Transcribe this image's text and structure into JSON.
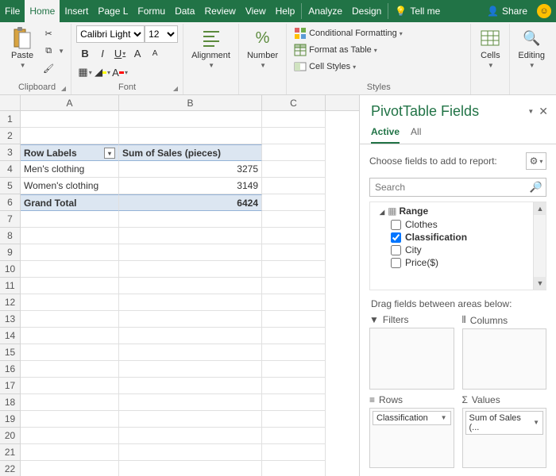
{
  "menubar": {
    "tabs": [
      "File",
      "Home",
      "Insert",
      "Page L",
      "Formu",
      "Data",
      "Review",
      "View",
      "Help",
      "Analyze",
      "Design"
    ],
    "active": "Home",
    "tellme": "Tell me",
    "share": "Share"
  },
  "ribbon": {
    "clipboard": {
      "label": "Clipboard",
      "paste": "Paste"
    },
    "font": {
      "label": "Font",
      "name": "Calibri Light",
      "size": "12",
      "bold": "B",
      "italic": "I",
      "underline": "U"
    },
    "alignment": {
      "label": "Alignment"
    },
    "number": {
      "label": "Number"
    },
    "styles": {
      "label": "Styles",
      "cond": "Conditional Formatting",
      "table": "Format as Table",
      "cell": "Cell Styles"
    },
    "cells": {
      "label": "Cells"
    },
    "editing": {
      "label": "Editing"
    }
  },
  "sheet": {
    "cols": [
      "A",
      "B",
      "C"
    ],
    "pivot": {
      "row_header": "Row Labels",
      "val_header": "Sum of Sales (pieces)",
      "rows": [
        {
          "label": "Men's clothing",
          "value": "3275"
        },
        {
          "label": "Women's clothing",
          "value": "3149"
        }
      ],
      "total_label": "Grand Total",
      "total_value": "6424"
    }
  },
  "pane": {
    "title": "PivotTable Fields",
    "tabs": {
      "active": "Active",
      "all": "All"
    },
    "hint": "Choose fields to add to report:",
    "search_placeholder": "Search",
    "group": "Range",
    "fields": [
      {
        "name": "Clothes",
        "checked": false,
        "bold": false
      },
      {
        "name": "Classification",
        "checked": true,
        "bold": true
      },
      {
        "name": "City",
        "checked": false,
        "bold": false
      },
      {
        "name": "Price($)",
        "checked": false,
        "bold": false
      }
    ],
    "drag_label": "Drag fields between areas below:",
    "areas": {
      "filters": "Filters",
      "columns": "Columns",
      "rows": "Rows",
      "values": "Values",
      "row_item": "Classification",
      "val_item": "Sum of Sales (..."
    }
  },
  "colors": {
    "brand": "#217346",
    "ribbon_bg": "#f3f3f3",
    "pivot_bg": "#dce6f1"
  }
}
